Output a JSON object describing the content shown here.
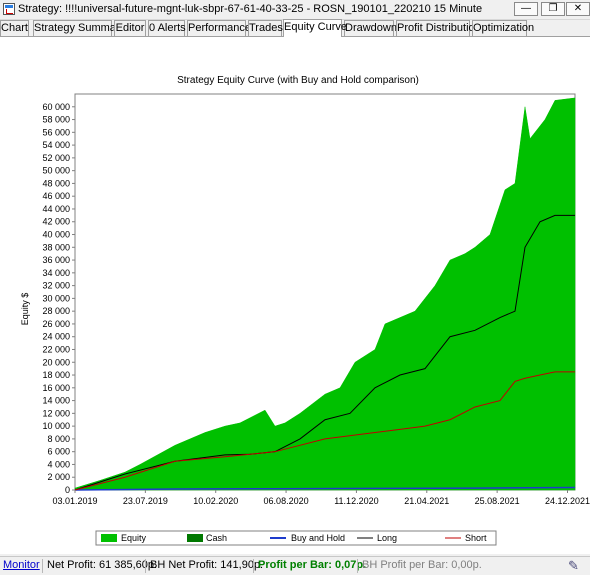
{
  "window": {
    "title": "Strategy: !!!!universal-future-mgnt-luk-sbpr-67-61-40-33-25 - ROSN_190101_220210 15 Minute",
    "minimize_glyph": "—",
    "restore_glyph": "❐",
    "close_glyph": "✕"
  },
  "tabs": [
    "Chart",
    "Strategy Summary",
    "Editor",
    "0 Alerts",
    "Performance",
    "Trades",
    "Equity Curve",
    "Drawdown",
    "Profit Distribution",
    "Optimization"
  ],
  "active_tab": "Equity Curve",
  "chart_data": {
    "type": "area",
    "title": "Strategy Equity Curve (with Buy and Hold comparison)",
    "ylabel": "Equity $",
    "xlabel": "",
    "ylim": [
      0,
      62000
    ],
    "y_ticks": [
      "0",
      "2 000",
      "4 000",
      "6 000",
      "8 000",
      "10 000",
      "12 000",
      "14 000",
      "16 000",
      "18 000",
      "20 000",
      "22 000",
      "24 000",
      "26 000",
      "28 000",
      "30 000",
      "32 000",
      "34 000",
      "36 000",
      "38 000",
      "40 000",
      "42 000",
      "44 000",
      "46 000",
      "48 000",
      "50 000",
      "52 000",
      "54 000",
      "56 000",
      "58 000",
      "60 000"
    ],
    "x_ticks": [
      "03.01.2019",
      "23.07.2019",
      "10.02.2020",
      "06.08.2020",
      "11.12.2020",
      "21.04.2021",
      "25.08.2021",
      "24.12.2021"
    ],
    "grid": false,
    "legend_position": "bottom",
    "series": [
      {
        "name": "Equity",
        "color": "#00c000",
        "style": "area",
        "x": [
          0,
          0.05,
          0.1,
          0.13,
          0.2,
          0.26,
          0.3,
          0.33,
          0.38,
          0.4,
          0.42,
          0.45,
          0.5,
          0.53,
          0.56,
          0.6,
          0.62,
          0.65,
          0.68,
          0.7,
          0.72,
          0.75,
          0.78,
          0.8,
          0.83,
          0.86,
          0.88,
          0.9,
          0.91,
          0.94,
          0.96,
          1.0
        ],
        "y": [
          300,
          1500,
          2800,
          4000,
          7000,
          9000,
          10000,
          10500,
          12500,
          10000,
          10500,
          12000,
          15000,
          16000,
          20000,
          22000,
          26000,
          27000,
          28000,
          30000,
          32000,
          36000,
          37000,
          38000,
          40000,
          47000,
          48000,
          60000,
          55000,
          58000,
          61000,
          61385
        ]
      },
      {
        "name": "Cash",
        "color": "#007800",
        "style": "area"
      },
      {
        "name": "Buy and Hold",
        "color": "#1e3ccc",
        "style": "line",
        "x": [
          0,
          0.2,
          0.4,
          0.6,
          0.8,
          1.0
        ],
        "y": [
          0,
          150,
          200,
          250,
          300,
          400
        ]
      },
      {
        "name": "Long",
        "color": "#000000",
        "style": "line",
        "x": [
          0,
          0.1,
          0.2,
          0.3,
          0.35,
          0.4,
          0.45,
          0.5,
          0.55,
          0.6,
          0.65,
          0.7,
          0.75,
          0.8,
          0.85,
          0.88,
          0.9,
          0.93,
          0.96,
          1.0
        ],
        "y": [
          0,
          2500,
          4500,
          5500,
          5600,
          6000,
          8000,
          11000,
          12000,
          16000,
          18000,
          19000,
          24000,
          25000,
          27000,
          28000,
          38000,
          42000,
          43000,
          43000
        ]
      },
      {
        "name": "Short",
        "color": "#c00000",
        "style": "line",
        "x": [
          0,
          0.1,
          0.2,
          0.3,
          0.4,
          0.5,
          0.6,
          0.65,
          0.7,
          0.75,
          0.8,
          0.85,
          0.88,
          0.9,
          0.93,
          0.96,
          1.0
        ],
        "y": [
          0,
          2000,
          4500,
          5200,
          6000,
          8000,
          9000,
          9500,
          10000,
          11000,
          13000,
          14000,
          17000,
          17500,
          18000,
          18500,
          18500
        ]
      }
    ]
  },
  "legend": {
    "equity": "Equity",
    "cash": "Cash",
    "buy_hold": "Buy and Hold",
    "long": "Long",
    "short": "Short"
  },
  "status": {
    "monitor": "Monitor",
    "net_profit": "Net Profit: 61 385,60р.",
    "bh_net_profit": "BH Net Profit: 141,90р.",
    "profit_per_bar": "Profit per Bar: 0,07р.",
    "bh_profit_per_bar": "BH Profit per Bar: 0,00р.",
    "monitor_color": "#0000cc",
    "profit_color": "#008000",
    "disabled_color": "#808080"
  }
}
